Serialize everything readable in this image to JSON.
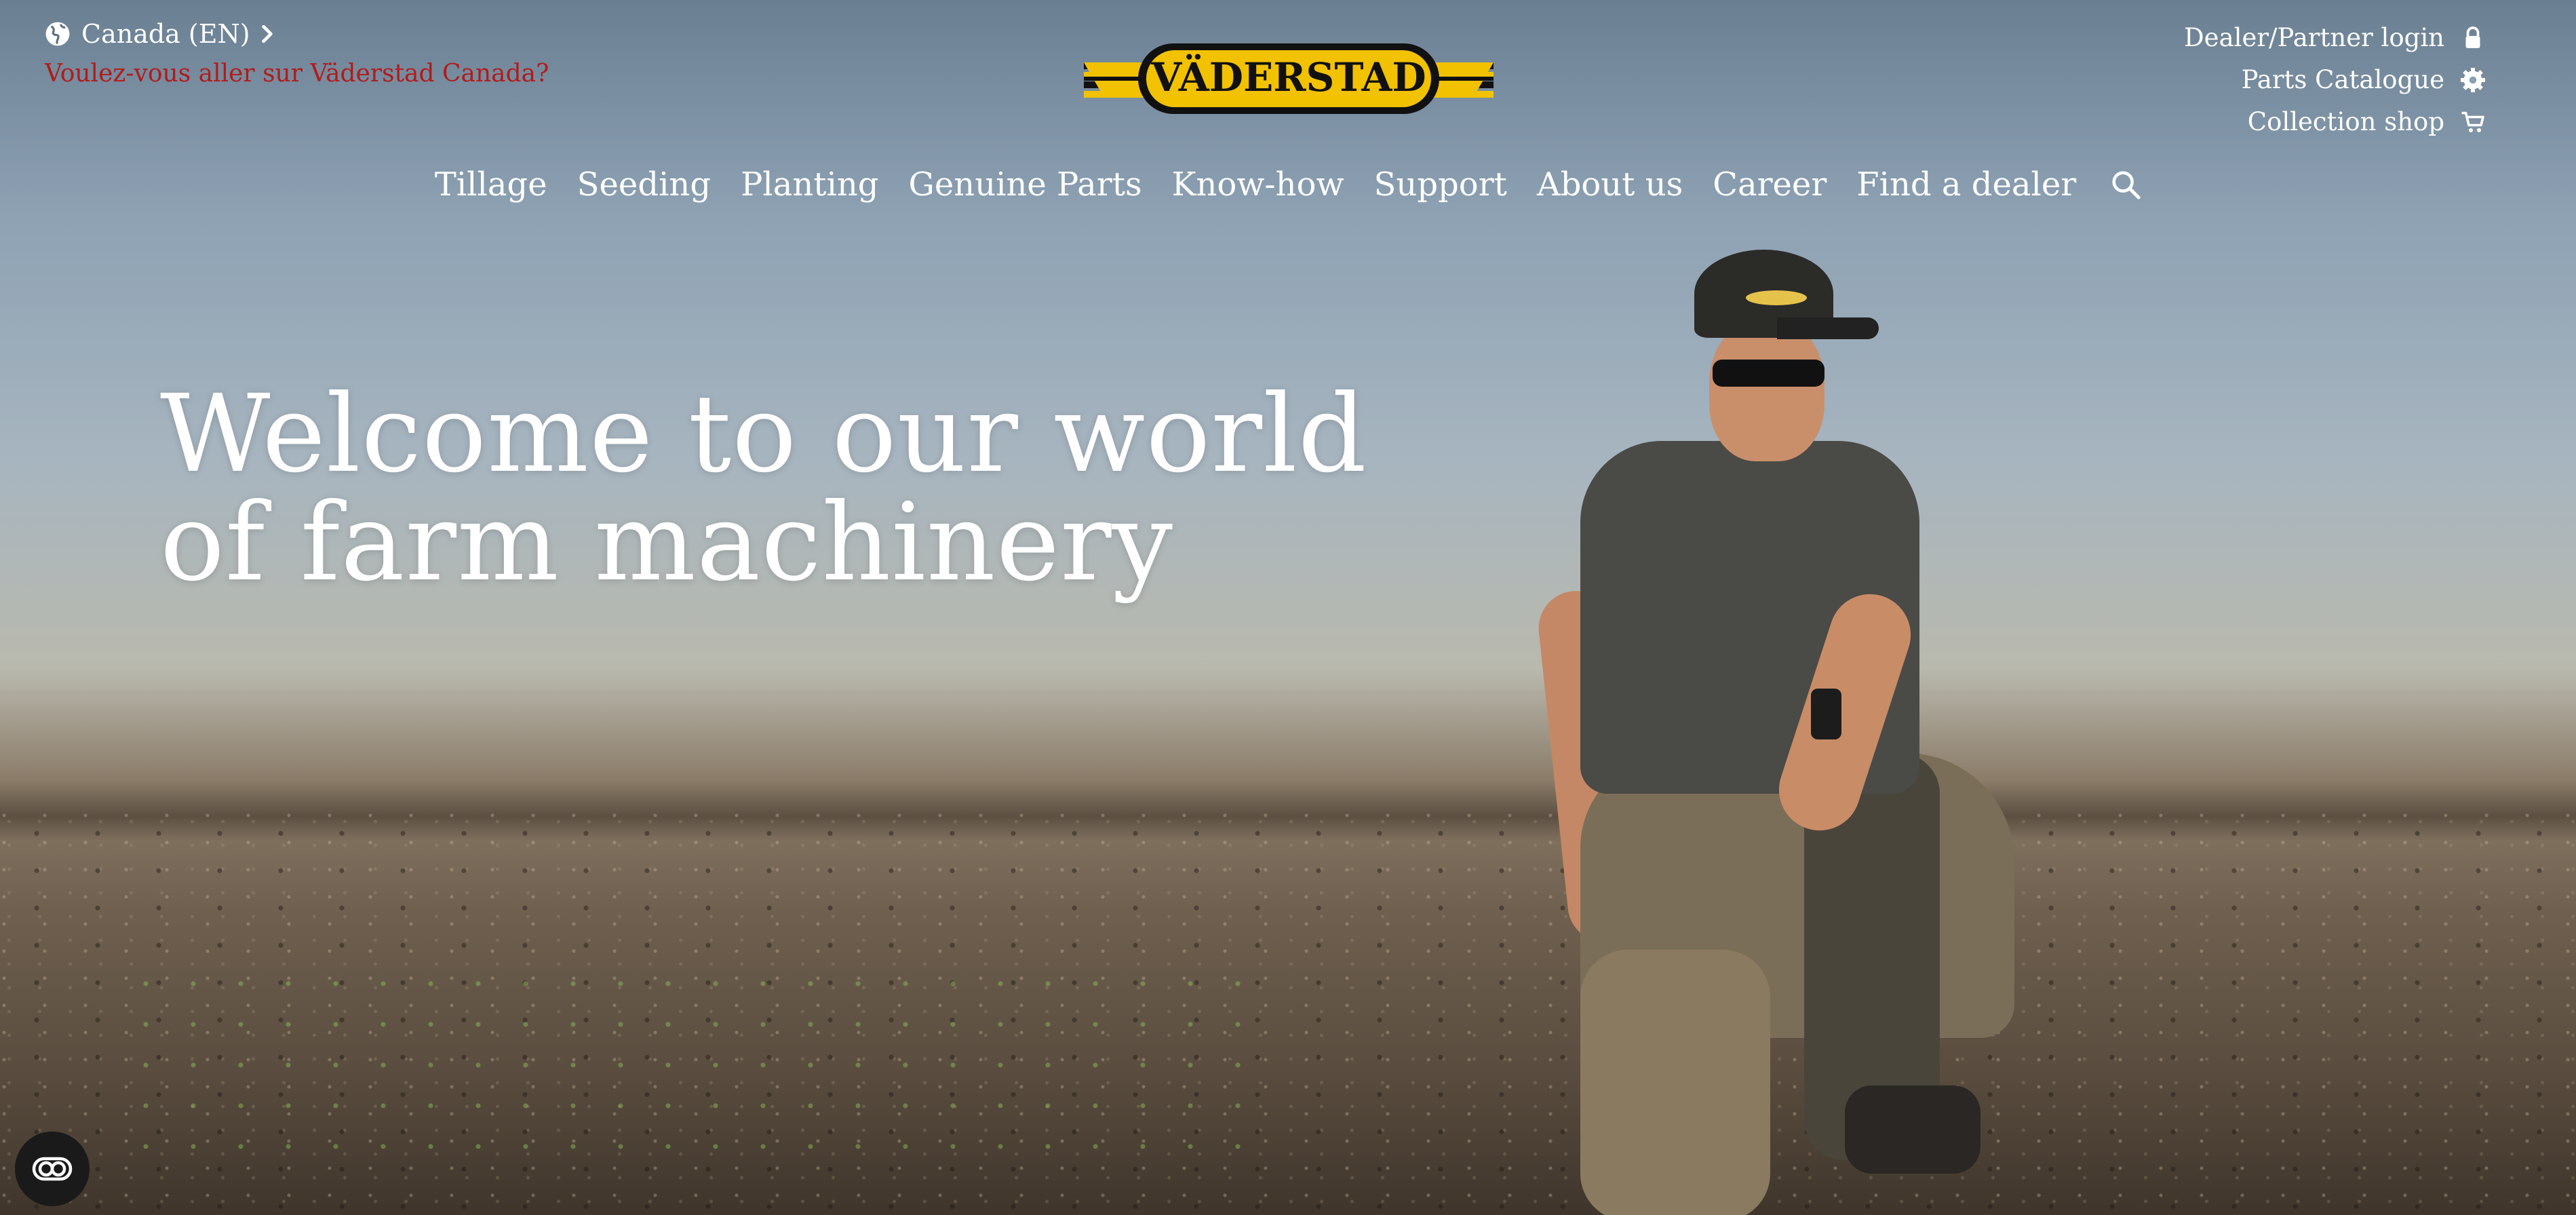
{
  "locale": {
    "current": "Canada (EN)",
    "suggestion": "Voulez-vous aller sur Väderstad Canada?"
  },
  "brand": {
    "logo_text": "VÄDERSTAD",
    "logo_color": "#f2c200"
  },
  "utilities": {
    "dealer_login": "Dealer/Partner login",
    "parts_catalogue": "Parts Catalogue",
    "collection_shop": "Collection shop"
  },
  "nav": {
    "items": [
      "Tillage",
      "Seeding",
      "Planting",
      "Genuine Parts",
      "Know-how",
      "Support",
      "About us",
      "Career",
      "Find a dealer"
    ]
  },
  "hero": {
    "headline_line1": "Welcome to our world",
    "headline_line2": "of farm machinery"
  },
  "icons": {
    "globe": "globe-icon",
    "chevron": "chevron-right-icon",
    "lock": "lock-icon",
    "gear": "gear-icon",
    "cart": "cart-icon",
    "search": "search-icon",
    "cookie": "cookie-settings-icon"
  }
}
